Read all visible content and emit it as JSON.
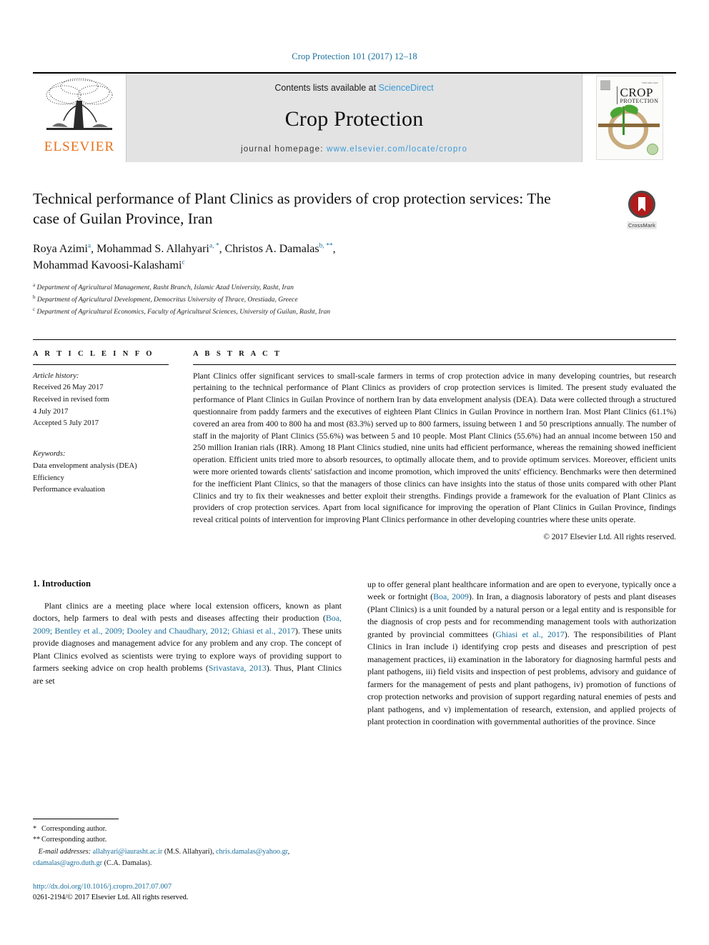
{
  "running_head": "Crop Protection 101 (2017) 12–18",
  "banner": {
    "publisher_logo_name": "elsevier-tree-logo",
    "publisher_wordmark": "ELSEVIER",
    "contents_prefix": "Contents lists available at ",
    "contents_link": "ScienceDirect",
    "journal_title": "Crop Protection",
    "homepage_prefix": "journal homepage: ",
    "homepage_url": "www.elsevier.com/locate/cropro",
    "cover_title_line1": "CROP",
    "cover_title_line2": "PROTECTION"
  },
  "article": {
    "title": "Technical performance of Plant Clinics as providers of crop protection services: The case of Guilan Province, Iran",
    "authors": [
      {
        "name": "Roya Azimi",
        "marks": "a"
      },
      {
        "name": "Mohammad S. Allahyari",
        "marks": "a, *"
      },
      {
        "name": "Christos A. Damalas",
        "marks": "b, **"
      },
      {
        "name": "Mohammad Kavoosi-Kalashami",
        "marks": "c"
      }
    ],
    "affiliations": [
      {
        "mark": "a",
        "text": "Department of Agricultural Management, Rasht Branch, Islamic Azad University, Rasht, Iran"
      },
      {
        "mark": "b",
        "text": "Department of Agricultural Development, Democritus University of Thrace, Orestiada, Greece"
      },
      {
        "mark": "c",
        "text": "Department of Agricultural Economics, Faculty of Agricultural Sciences, University of Guilan, Rasht, Iran"
      }
    ],
    "crossmark_label": "CrossMark"
  },
  "info": {
    "heading": "A R T I C L E  I N F O",
    "history_label": "Article history:",
    "history": [
      "Received 26 May 2017",
      "Received in revised form",
      "4 July 2017",
      "Accepted 5 July 2017"
    ],
    "keywords_label": "Keywords:",
    "keywords": [
      "Data envelopment analysis (DEA)",
      "Efficiency",
      "Performance evaluation"
    ]
  },
  "abstract": {
    "heading": "A B S T R A C T",
    "text": "Plant Clinics offer significant services to small-scale farmers in terms of crop protection advice in many developing countries, but research pertaining to the technical performance of Plant Clinics as providers of crop protection services is limited. The present study evaluated the performance of Plant Clinics in Guilan Province of northern Iran by data envelopment analysis (DEA). Data were collected through a structured questionnaire from paddy farmers and the executives of eighteen Plant Clinics in Guilan Province in northern Iran. Most Plant Clinics (61.1%) covered an area from 400 to 800 ha and most (83.3%) served up to 800 farmers, issuing between 1 and 50 prescriptions annually. The number of staff in the majority of Plant Clinics (55.6%) was between 5 and 10 people. Most Plant Clinics (55.6%) had an annual income between 150 and 250 million Iranian rials (IRR). Among 18 Plant Clinics studied, nine units had efficient performance, whereas the remaining showed inefficient operation. Efficient units tried more to absorb resources, to optimally allocate them, and to provide optimum services. Moreover, efficient units were more oriented towards clients' satisfaction and income promotion, which improved the units' efficiency. Benchmarks were then determined for the inefficient Plant Clinics, so that the managers of those clinics can have insights into the status of those units compared with other Plant Clinics and try to fix their weaknesses and better exploit their strengths. Findings provide a framework for the evaluation of Plant Clinics as providers of crop protection services. Apart from local significance for improving the operation of Plant Clinics in Guilan Province, findings reveal critical points of intervention for improving Plant Clinics performance in other developing countries where these units operate.",
    "copyright": "© 2017 Elsevier Ltd. All rights reserved."
  },
  "section": {
    "number_title": "1. Introduction",
    "left_para_parts": [
      "Plant clinics are a meeting place where local extension officers, known as plant doctors, help farmers to deal with pests and diseases affecting their production (",
      "Boa, 2009; Bentley et al., 2009; Dooley and Chaudhary, 2012; Ghiasi et al., 2017",
      "). These units provide diagnoses and management advice for any problem and any crop. The concept of Plant Clinics evolved as scientists were trying to explore ways of providing support to farmers seeking advice on crop health problems (",
      "Srivastava, 2013",
      "). Thus, Plant Clinics are set"
    ],
    "right_para_parts": [
      "up to offer general plant healthcare information and are open to everyone, typically once a week or fortnight (",
      "Boa, 2009",
      "). In Iran, a diagnosis laboratory of pests and plant diseases (Plant Clinics) is a unit founded by a natural person or a legal entity and is responsible for the diagnosis of crop pests and for recommending management tools with authorization granted by provincial committees (",
      "Ghiasi et al., 2017",
      "). The responsibilities of Plant Clinics in Iran include i) identifying crop pests and diseases and prescription of pest management practices, ii) examination in the laboratory for diagnosing harmful pests and plant pathogens, iii) field visits and inspection of pest problems, advisory and guidance of farmers for the management of pests and plant pathogens, iv) promotion of functions of crop protection networks and provision of support regarding natural enemies of pests and plant pathogens, and v) implementation of research, extension, and applied projects of plant protection in coordination with governmental authorities of the province. Since"
    ]
  },
  "footnotes": {
    "corresponding_1": "Corresponding author.",
    "corresponding_2": "Corresponding author.",
    "emails_label": "E-mail addresses:",
    "email_1": "allahyari@iaurasht.ac.ir",
    "email_1_owner": "(M.S. Allahyari),",
    "email_2": "chris.damalas@yahoo.gr",
    "email_3": "cdamalas@agro.duth.gr",
    "email_owner_2": "(C.A. Damalas).",
    "doi": "http://dx.doi.org/10.1016/j.cropro.2017.07.007",
    "issn_line": "0261-2194/© 2017 Elsevier Ltd. All rights reserved."
  },
  "colors": {
    "link": "#1a6f9c",
    "science_direct": "#3a9ad9",
    "elsevier_orange": "#E8711A",
    "banner_bg": "#e3e3e3",
    "crossmark_red": "#b01c1c"
  }
}
